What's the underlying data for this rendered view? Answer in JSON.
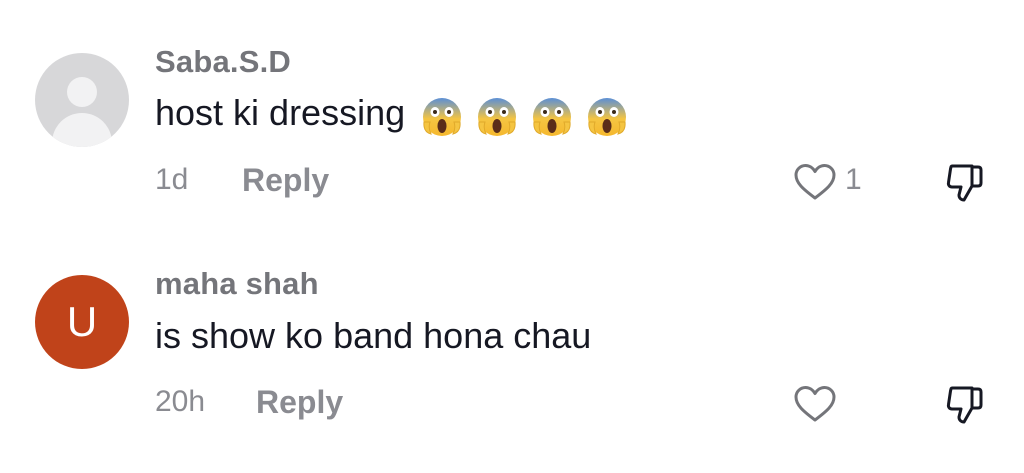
{
  "comments": [
    {
      "username": "Saba.S.D",
      "text": "host ki dressing",
      "emojis": [
        "face-screaming-in-fear-emoji",
        "face-screaming-in-fear-emoji",
        "face-screaming-in-fear-emoji",
        "face-screaming-in-fear-emoji"
      ],
      "time": "1d",
      "reply_label": "Reply",
      "like_count": "1",
      "avatar_initial": ""
    },
    {
      "username": "maha shah",
      "text": "is show ko band hona chau",
      "emojis": [],
      "time": "20h",
      "reply_label": "Reply",
      "like_count": "",
      "avatar_initial": "U"
    }
  ],
  "colors": {
    "text": "#161823",
    "secondary": "#8a8b91",
    "username": "#74757a",
    "avatar_default": "#d7d7d9",
    "avatar_user": "#c0431a",
    "emoji_face": "#f5c542"
  },
  "icons": [
    "heart-outline-icon",
    "thumbs-down-outline-icon",
    "default-avatar-icon"
  ]
}
